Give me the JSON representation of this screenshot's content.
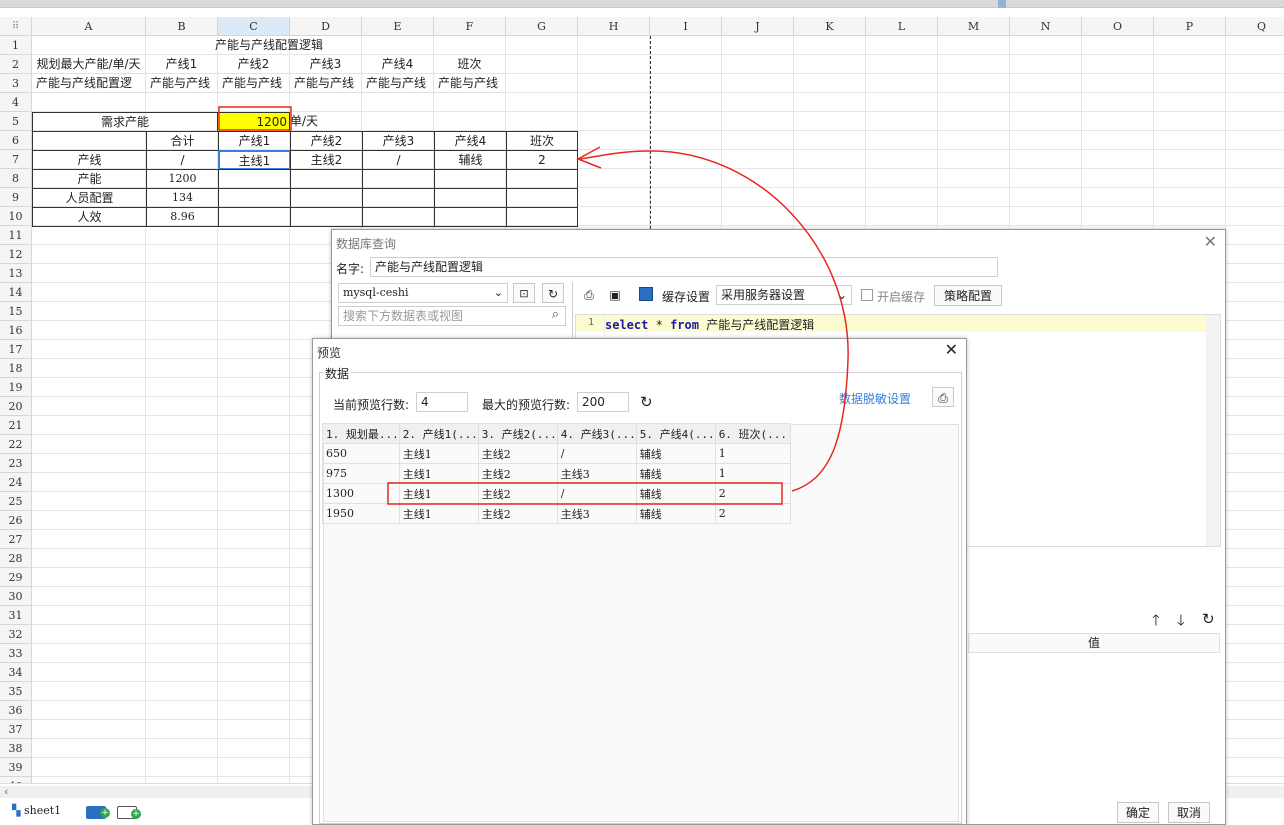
{
  "spreadsheet": {
    "columns": [
      "A",
      "B",
      "C",
      "D",
      "E",
      "F",
      "G",
      "H",
      "I",
      "J",
      "K",
      "L",
      "M",
      "N",
      "O",
      "P",
      "Q"
    ],
    "active_column": "C",
    "row_numbers": [
      "1",
      "2",
      "3",
      "4",
      "5",
      "6",
      "7",
      "8",
      "9",
      "10",
      "11",
      "12",
      "13",
      "14",
      "15",
      "16",
      "17",
      "18",
      "19",
      "20",
      "21",
      "22",
      "23",
      "24",
      "25",
      "26",
      "27",
      "28",
      "29",
      "30",
      "31",
      "32",
      "33",
      "34",
      "35",
      "36",
      "37",
      "38",
      "39",
      "40"
    ],
    "title": "产能与产线配置逻辑",
    "row2": [
      "规划最大产能/单/天",
      "产线1",
      "产线2",
      "产线3",
      "产线4",
      "班次"
    ],
    "row3": [
      "产能与产线配置逻",
      "产能与产线",
      "产能与产线",
      "产能与产线",
      "产能与产线",
      "产能与产线"
    ],
    "demand_label": "需求产能",
    "demand_value": "1200",
    "demand_unit": "单/天",
    "row6": [
      "合计",
      "产线1",
      "产线2",
      "产线3",
      "产线4",
      "班次"
    ],
    "row7": [
      "产线",
      "/",
      "主线1",
      "主线2",
      "/",
      "辅线",
      "2"
    ],
    "row8": [
      "产能",
      "1200"
    ],
    "row9": [
      "人员配置",
      "134"
    ],
    "row10": [
      "人效",
      "8.96"
    ],
    "sheet_tab": "sheet1",
    "highlight_color": "#ffff00"
  },
  "db_dialog": {
    "title": "数据库查询",
    "name_label": "名字:",
    "name_value": "产能与产线配置逻辑",
    "connection": "mysql-ceshi",
    "search_placeholder": "搜索下方数据表或视图",
    "cache_label": "缓存设置",
    "cache_value": "采用服务器设置",
    "enable_cache_label": "开启缓存",
    "strategy_button": "策略配置",
    "sql_line_no": "1",
    "sql_kw_select": "select",
    "sql_star": "*",
    "sql_kw_from": "from",
    "sql_table": "产能与产线配置逻辑",
    "value_header": "值",
    "ok_button": "确定",
    "cancel_button": "取消"
  },
  "preview_dialog": {
    "title": "预览",
    "section_label": "数据",
    "current_rows_label": "当前预览行数:",
    "current_rows_value": "4",
    "max_rows_label": "最大的预览行数:",
    "max_rows_value": "200",
    "desensitize_link": "数据脱敏设置",
    "headers": [
      "1. 规划最...",
      "2. 产线1(...",
      "3. 产线2(...",
      "4. 产线3(...",
      "5. 产线4(...",
      "6. 班次(..."
    ],
    "rows": [
      [
        "650",
        "主线1",
        "主线2",
        "/",
        "辅线",
        "1"
      ],
      [
        "975",
        "主线1",
        "主线2",
        "主线3",
        "辅线",
        "1"
      ],
      [
        "1300",
        "主线1",
        "主线2",
        "/",
        "辅线",
        "2"
      ],
      [
        "1950",
        "主线1",
        "主线2",
        "主线3",
        "辅线",
        "2"
      ]
    ],
    "highlighted_row": 3
  },
  "colors": {
    "annotation_red": "#e8281f",
    "link_blue": "#3a7fd5",
    "sql_keyword": "#1a1aa6",
    "sql_line_bg": "#fdfbd0"
  }
}
